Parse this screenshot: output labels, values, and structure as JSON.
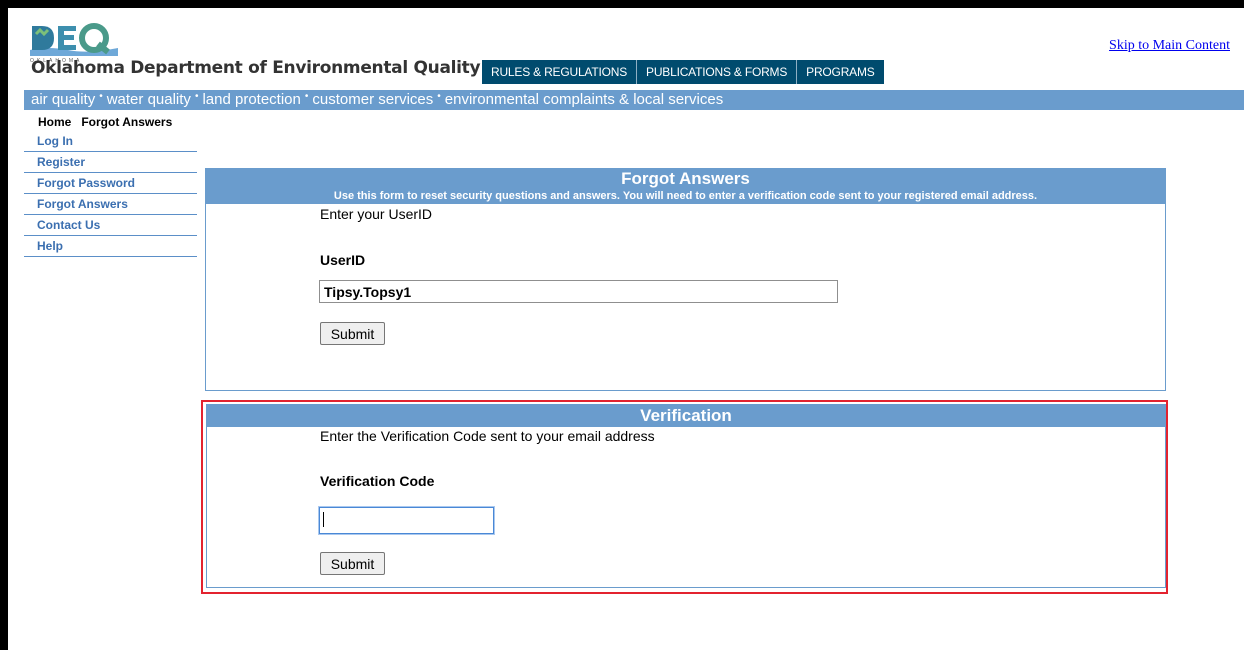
{
  "header": {
    "logo_text": "DEQ",
    "logo_state_text": "OKLAHOMA",
    "agency_name": "Oklahoma Department of Environmental Quality",
    "skip_link": "Skip to Main Content",
    "tabs": [
      {
        "label": "RULES & REGULATIONS"
      },
      {
        "label": "PUBLICATIONS & FORMS"
      },
      {
        "label": "PROGRAMS"
      }
    ]
  },
  "nav": {
    "items": [
      {
        "label": "air quality"
      },
      {
        "label": "water quality"
      },
      {
        "label": "land protection"
      },
      {
        "label": "customer services"
      },
      {
        "label": "environmental complaints & local services"
      }
    ],
    "separator": "•"
  },
  "breadcrumb": {
    "home": "Home",
    "current": "Forgot Answers"
  },
  "sidebar": {
    "items": [
      {
        "label": "Log In"
      },
      {
        "label": "Register"
      },
      {
        "label": "Forgot Password"
      },
      {
        "label": "Forgot Answers"
      },
      {
        "label": "Contact Us"
      },
      {
        "label": "Help"
      }
    ]
  },
  "forgot_panel": {
    "title": "Forgot Answers",
    "subtitle": "Use this form to reset security questions and answers. You will need to enter a verification code sent to your registered email address.",
    "instruction": "Enter your UserID",
    "field_label": "UserID",
    "field_value": "Tipsy.Topsy1",
    "submit_label": "Submit"
  },
  "verification_panel": {
    "title": "Verification",
    "instruction": "Enter the Verification Code sent to your email address",
    "field_label": "Verification Code",
    "field_value": "",
    "submit_label": "Submit"
  },
  "colors": {
    "panel_header": "#6a9ccd",
    "tab_bg": "#004b6e",
    "link": "#3b6fb0",
    "highlight": "#e3232f"
  }
}
